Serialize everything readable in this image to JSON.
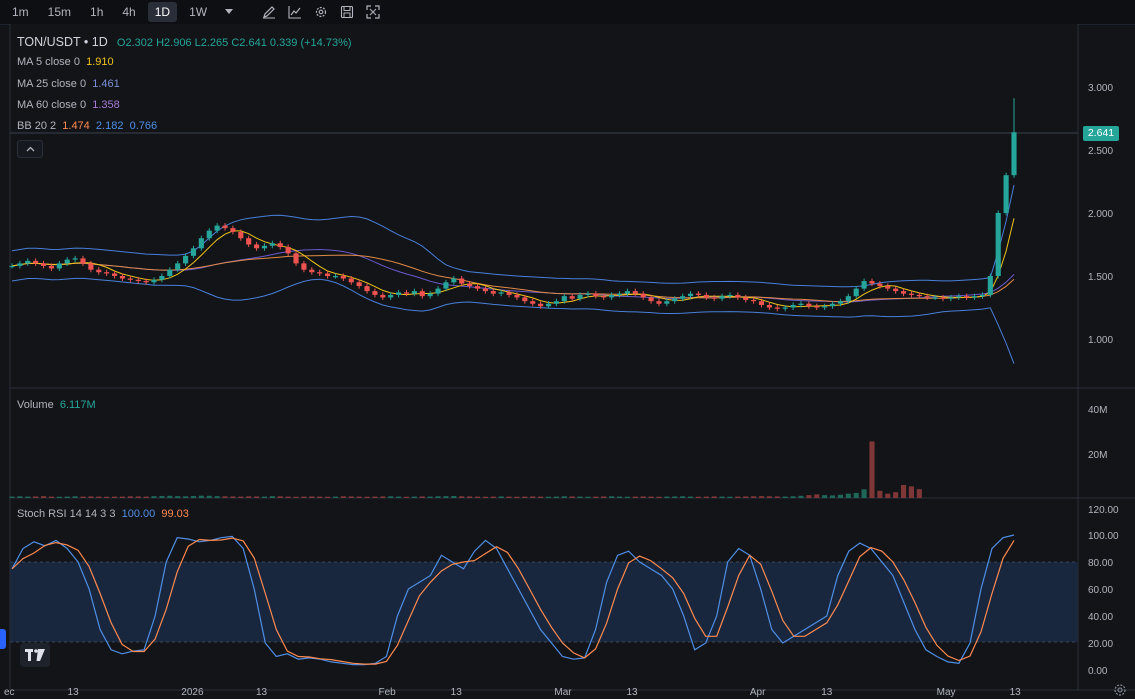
{
  "toolbar": {
    "timeframes": [
      "1m",
      "15m",
      "1h",
      "4h",
      "1D",
      "1W"
    ],
    "active_timeframe": "1D",
    "tools": [
      "dropdown-icon",
      "pencil-icon",
      "line-chart-icon",
      "gear-icon",
      "save-icon",
      "fullscreen-icon"
    ]
  },
  "legend": {
    "symbol": "TON/USDT • 1D",
    "ohlc": {
      "open": "O2.302",
      "high": "H2.906",
      "low": "L2.265",
      "close": "C2.641",
      "change": "0.339 (+14.73%)"
    },
    "ma5": {
      "label": "MA 5 close 0",
      "value": "1.910"
    },
    "ma25": {
      "label": "MA 25 close 0",
      "value": "1.461"
    },
    "ma60": {
      "label": "MA 60 close 0",
      "value": "1.358"
    },
    "bb": {
      "label": "BB 20 2",
      "basis": "1.474",
      "upper": "2.182",
      "lower": "0.766"
    },
    "volume": {
      "label": "Volume",
      "value": "6.117M"
    },
    "stoch": {
      "label": "Stoch RSI 14 14 3 3",
      "k": "100.00",
      "d": "99.03"
    }
  },
  "current_price": "2.641",
  "colors": {
    "up": "#26a69a",
    "down": "#ef5350",
    "ma5": "#f0c419",
    "ma25": "#e08a46",
    "ma60": "#8a6fd6",
    "bb": "#4a7fd9",
    "stoch_k": "#4f8fe6",
    "stoch_d": "#ff8a50",
    "background": "#121418"
  },
  "chart_data": {
    "type": "candlestick",
    "price_axis": [
      "3.000",
      "2.500",
      "2.000",
      "1.500",
      "1.000"
    ],
    "volume_axis": [
      "40M",
      "20M"
    ],
    "stoch_axis": [
      "120.00",
      "100.00",
      "80.00",
      "60.00",
      "40.00",
      "20.00",
      "0.00"
    ],
    "x_labels": [
      "ec",
      "13",
      "2026",
      "13",
      "Feb",
      "13",
      "Mar",
      "13",
      "Apr",
      "13",
      "May",
      "13"
    ],
    "x_label_days": [
      0,
      11,
      30,
      41,
      61,
      72,
      89,
      100,
      120,
      131,
      150,
      161
    ],
    "price_range": [
      0.7,
      3.05
    ],
    "close_series": [
      1.58,
      1.6,
      1.62,
      1.6,
      1.58,
      1.56,
      1.6,
      1.63,
      1.64,
      1.6,
      1.55,
      1.53,
      1.52,
      1.5,
      1.48,
      1.47,
      1.46,
      1.45,
      1.47,
      1.5,
      1.55,
      1.6,
      1.66,
      1.72,
      1.8,
      1.86,
      1.9,
      1.88,
      1.85,
      1.8,
      1.75,
      1.72,
      1.74,
      1.76,
      1.73,
      1.68,
      1.6,
      1.55,
      1.53,
      1.52,
      1.5,
      1.5,
      1.48,
      1.45,
      1.42,
      1.38,
      1.35,
      1.33,
      1.35,
      1.37,
      1.36,
      1.38,
      1.34,
      1.36,
      1.4,
      1.45,
      1.48,
      1.44,
      1.42,
      1.4,
      1.38,
      1.36,
      1.37,
      1.35,
      1.33,
      1.3,
      1.28,
      1.26,
      1.28,
      1.3,
      1.34,
      1.32,
      1.35,
      1.36,
      1.34,
      1.33,
      1.35,
      1.36,
      1.38,
      1.36,
      1.33,
      1.3,
      1.28,
      1.3,
      1.32,
      1.34,
      1.36,
      1.35,
      1.33,
      1.32,
      1.34,
      1.35,
      1.33,
      1.31,
      1.3,
      1.27,
      1.25,
      1.24,
      1.25,
      1.27,
      1.28,
      1.26,
      1.25,
      1.26,
      1.28,
      1.3,
      1.34,
      1.4,
      1.46,
      1.44,
      1.42,
      1.4,
      1.38,
      1.36,
      1.35,
      1.34,
      1.33,
      1.33,
      1.32,
      1.33,
      1.34,
      1.33,
      1.34,
      1.35,
      1.5,
      2.0,
      2.3,
      2.641
    ],
    "volume_series_millions": [
      1,
      1.2,
      1,
      1.1,
      1.3,
      1,
      0.9,
      1,
      1.2,
      1,
      1.1,
      1,
      0.9,
      1,
      1,
      1.2,
      1.1,
      1,
      1.3,
      1.4,
      1.5,
      1.3,
      1.2,
      1.4,
      1.6,
      1.5,
      1.3,
      1.2,
      1.1,
      1,
      1.2,
      1.1,
      1,
      1.3,
      1.2,
      1,
      0.9,
      1,
      1.1,
      1,
      0.9,
      1,
      1.2,
      1.1,
      1,
      0.9,
      1,
      1.1,
      1.2,
      1,
      0.9,
      1,
      1.1,
      1,
      1.2,
      1.3,
      1.4,
      1.2,
      1.1,
      1,
      0.9,
      1,
      1.1,
      1,
      0.9,
      1,
      1.1,
      1,
      0.9,
      1,
      1.2,
      1.1,
      1,
      0.9,
      1,
      1.1,
      1.2,
      1,
      0.9,
      1,
      1.1,
      1,
      0.9,
      1,
      1.1,
      1.2,
      1,
      0.9,
      1,
      1.1,
      1,
      0.9,
      1,
      1.1,
      1.2,
      1.3,
      1.2,
      1.1,
      1,
      1.2,
      1.5,
      2,
      2.5,
      2,
      1.8,
      2.2,
      3,
      3.5,
      6,
      39,
      5,
      3,
      4,
      9,
      8,
      6.117
    ],
    "stoch_k_series": [
      75,
      90,
      95,
      92,
      96,
      90,
      80,
      60,
      30,
      15,
      12,
      14,
      15,
      40,
      80,
      98,
      97,
      95,
      96,
      98,
      99,
      90,
      60,
      20,
      10,
      12,
      8,
      9,
      8,
      6,
      5,
      4,
      4,
      5,
      10,
      40,
      60,
      65,
      70,
      85,
      80,
      75,
      88,
      96,
      90,
      75,
      60,
      45,
      30,
      20,
      10,
      8,
      9,
      30,
      65,
      85,
      88,
      80,
      75,
      70,
      60,
      40,
      15,
      20,
      40,
      80,
      90,
      85,
      60,
      30,
      20,
      25,
      30,
      35,
      40,
      70,
      88,
      94,
      90,
      80,
      70,
      50,
      30,
      15,
      10,
      6,
      5,
      20,
      60,
      90,
      98,
      100
    ]
  }
}
